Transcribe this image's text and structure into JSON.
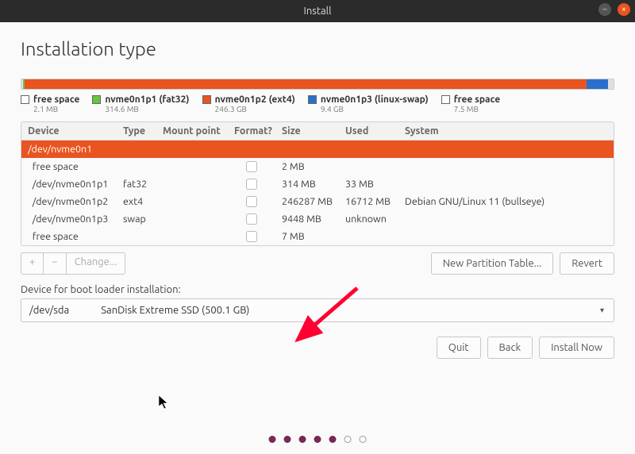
{
  "window": {
    "title": "Install"
  },
  "heading": "Installation type",
  "usage": [
    {
      "color": "#e0e0e0",
      "width": "0.3%"
    },
    {
      "color": "#67c63e",
      "width": "0.2%"
    },
    {
      "color": "#e95420",
      "width": "95%"
    },
    {
      "color": "#2b6fcc",
      "width": "3.5%"
    },
    {
      "color": "#e0e0e0",
      "width": "1%"
    }
  ],
  "legend": [
    {
      "color": "#ffffff",
      "name": "free space",
      "size": "2.1 MB"
    },
    {
      "color": "#67c63e",
      "name": "nvme0n1p1 (fat32)",
      "size": "314.6 MB"
    },
    {
      "color": "#e95420",
      "name": "nvme0n1p2 (ext4)",
      "size": "246.3 GB"
    },
    {
      "color": "#2b6fcc",
      "name": "nvme0n1p3 (linux-swap)",
      "size": "9.4 GB"
    },
    {
      "color": "#ffffff",
      "name": "free space",
      "size": "7.5 MB"
    }
  ],
  "columns": [
    "Device",
    "Type",
    "Mount point",
    "Format?",
    "Size",
    "Used",
    "System"
  ],
  "rows": [
    {
      "device": "/dev/nvme0n1",
      "type": "",
      "mount": "",
      "format": false,
      "size": "",
      "used": "",
      "system": "",
      "selected": true,
      "showchk": false
    },
    {
      "device": "  free space",
      "type": "",
      "mount": "",
      "format": false,
      "size": "2 MB",
      "used": "",
      "system": "",
      "selected": false,
      "showchk": true
    },
    {
      "device": "  /dev/nvme0n1p1",
      "type": "fat32",
      "mount": "",
      "format": false,
      "size": "314 MB",
      "used": "33 MB",
      "system": "",
      "selected": false,
      "showchk": true
    },
    {
      "device": "  /dev/nvme0n1p2",
      "type": "ext4",
      "mount": "",
      "format": false,
      "size": "246287 MB",
      "used": "16712 MB",
      "system": "Debian GNU/Linux 11 (bullseye)",
      "selected": false,
      "showchk": true
    },
    {
      "device": "  /dev/nvme0n1p3",
      "type": "swap",
      "mount": "",
      "format": false,
      "size": "9448 MB",
      "used": "unknown",
      "system": "",
      "selected": false,
      "showchk": true
    },
    {
      "device": "  free space",
      "type": "",
      "mount": "",
      "format": false,
      "size": "7 MB",
      "used": "",
      "system": "",
      "selected": false,
      "showchk": true
    }
  ],
  "toolbar": {
    "add": "+",
    "remove": "−",
    "change": "Change...",
    "new_table": "New Partition Table...",
    "revert": "Revert"
  },
  "bootloader": {
    "label": "Device for boot loader installation:",
    "device": "/dev/sda",
    "desc": "SanDisk Extreme SSD (500.1 GB)"
  },
  "actions": {
    "quit": "Quit",
    "back": "Back",
    "install": "Install Now"
  },
  "progress_dots": {
    "total": 7,
    "filled": 5
  }
}
